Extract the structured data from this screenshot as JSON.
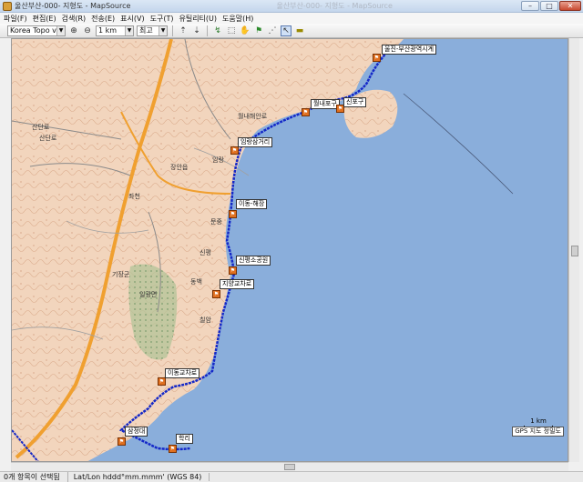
{
  "window": {
    "title": "울산부산-000- 지형도 - MapSource",
    "ghost_title": "울산부산-000- 지형도 - MapSource"
  },
  "menu": [
    {
      "label": "파일(F)"
    },
    {
      "label": "편집(E)"
    },
    {
      "label": "검색(R)"
    },
    {
      "label": "전송(E)"
    },
    {
      "label": "표시(V)"
    },
    {
      "label": "도구(T)"
    },
    {
      "label": "유틸리티(U)"
    },
    {
      "label": "도움말(H)"
    }
  ],
  "toolbar": {
    "map_product": "Korea Topo v1",
    "zoom_scale": "1 km",
    "detail_level": "최고",
    "icons": [
      "gps-send-icon",
      "gps-receive-icon",
      "zoom-tool-icon",
      "select-tool-icon",
      "hand-tool-icon",
      "waypoint-tool-icon",
      "route-tool-icon",
      "pointer-tool-icon",
      "measure-tool-icon"
    ]
  },
  "map": {
    "colors": {
      "sea": "#8aaedb",
      "land": "#f2d5bd",
      "route": "#1428c8",
      "road": "#f0a030"
    },
    "waypoints": [
      {
        "label": "울진-부산광역시계"
      },
      {
        "label": "월내포구"
      },
      {
        "label": "신포구"
      },
      {
        "label": "임랑삼거리"
      },
      {
        "label": "이동-해장"
      },
      {
        "label": "신평소공원"
      },
      {
        "label": "지양교차로"
      },
      {
        "label": "이동교차로"
      },
      {
        "label": "삼정대"
      },
      {
        "label": "학리"
      }
    ],
    "place_labels": [
      "산단로",
      "산단로",
      "장안읍",
      "임랑",
      "문중",
      "월내해안로",
      "임랑삼거리",
      "일광면",
      "기장군",
      "좌천",
      "신평",
      "동백",
      "칠암"
    ],
    "scale_label": "1 km",
    "gps_badge": "GPS 지도 정밀도"
  },
  "status": {
    "selection": "0개 항목이 선택됨",
    "coord_format": "Lat/Lon hddd°mm.mmm' (WGS 84)"
  }
}
